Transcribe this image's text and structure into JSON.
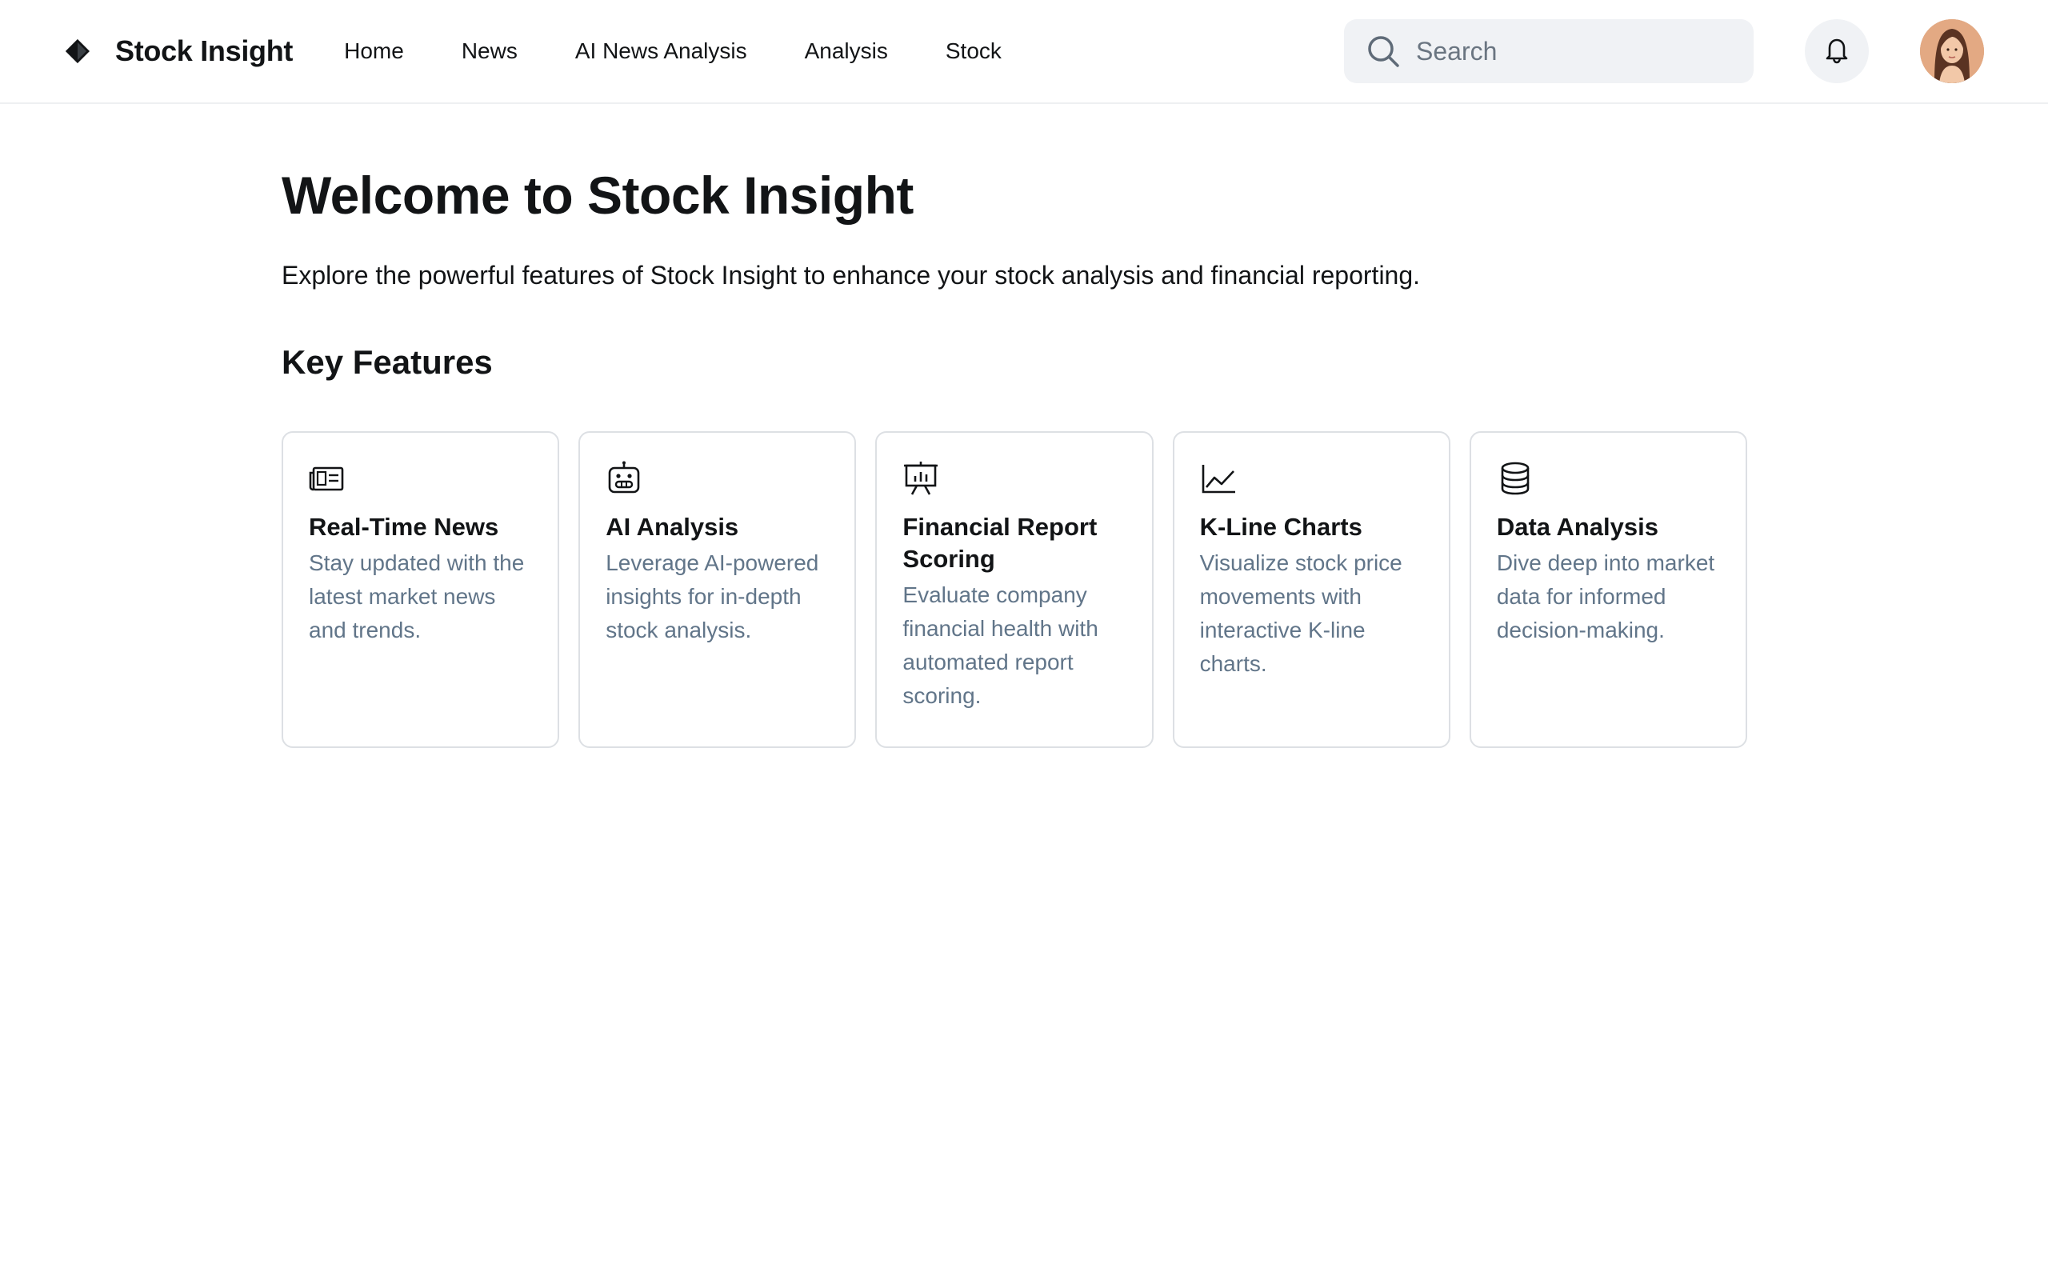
{
  "header": {
    "brand": "Stock Insight",
    "nav": [
      {
        "label": "Home"
      },
      {
        "label": "News"
      },
      {
        "label": "AI News Analysis"
      },
      {
        "label": "Analysis"
      },
      {
        "label": "Stock"
      }
    ],
    "search": {
      "placeholder": "Search",
      "value": ""
    },
    "icons": {
      "logo": "diamond-logo-icon",
      "search": "search-icon",
      "notifications": "bell-icon",
      "avatar": "user-avatar"
    }
  },
  "main": {
    "title": "Welcome to Stock Insight",
    "subtitle": "Explore the powerful features of Stock Insight to enhance your stock analysis and financial reporting.",
    "section_title": "Key Features",
    "features": [
      {
        "icon": "newspaper-icon",
        "title": "Real-Time News",
        "description": "Stay updated with the latest market news and trends."
      },
      {
        "icon": "robot-icon",
        "title": "AI Analysis",
        "description": "Leverage AI-powered insights for in-depth stock analysis."
      },
      {
        "icon": "presentation-chart-icon",
        "title": "Financial Report Scoring",
        "description": "Evaluate company financial health with automated report scoring."
      },
      {
        "icon": "line-chart-icon",
        "title": "K-Line Charts",
        "description": "Visualize stock price movements with interactive K-line charts."
      },
      {
        "icon": "database-icon",
        "title": "Data Analysis",
        "description": "Dive deep into market data for informed decision-making."
      }
    ]
  },
  "colors": {
    "text": "#121416",
    "muted": "#617589",
    "border": "#dde0e4",
    "search_bg": "#f0f2f5"
  }
}
